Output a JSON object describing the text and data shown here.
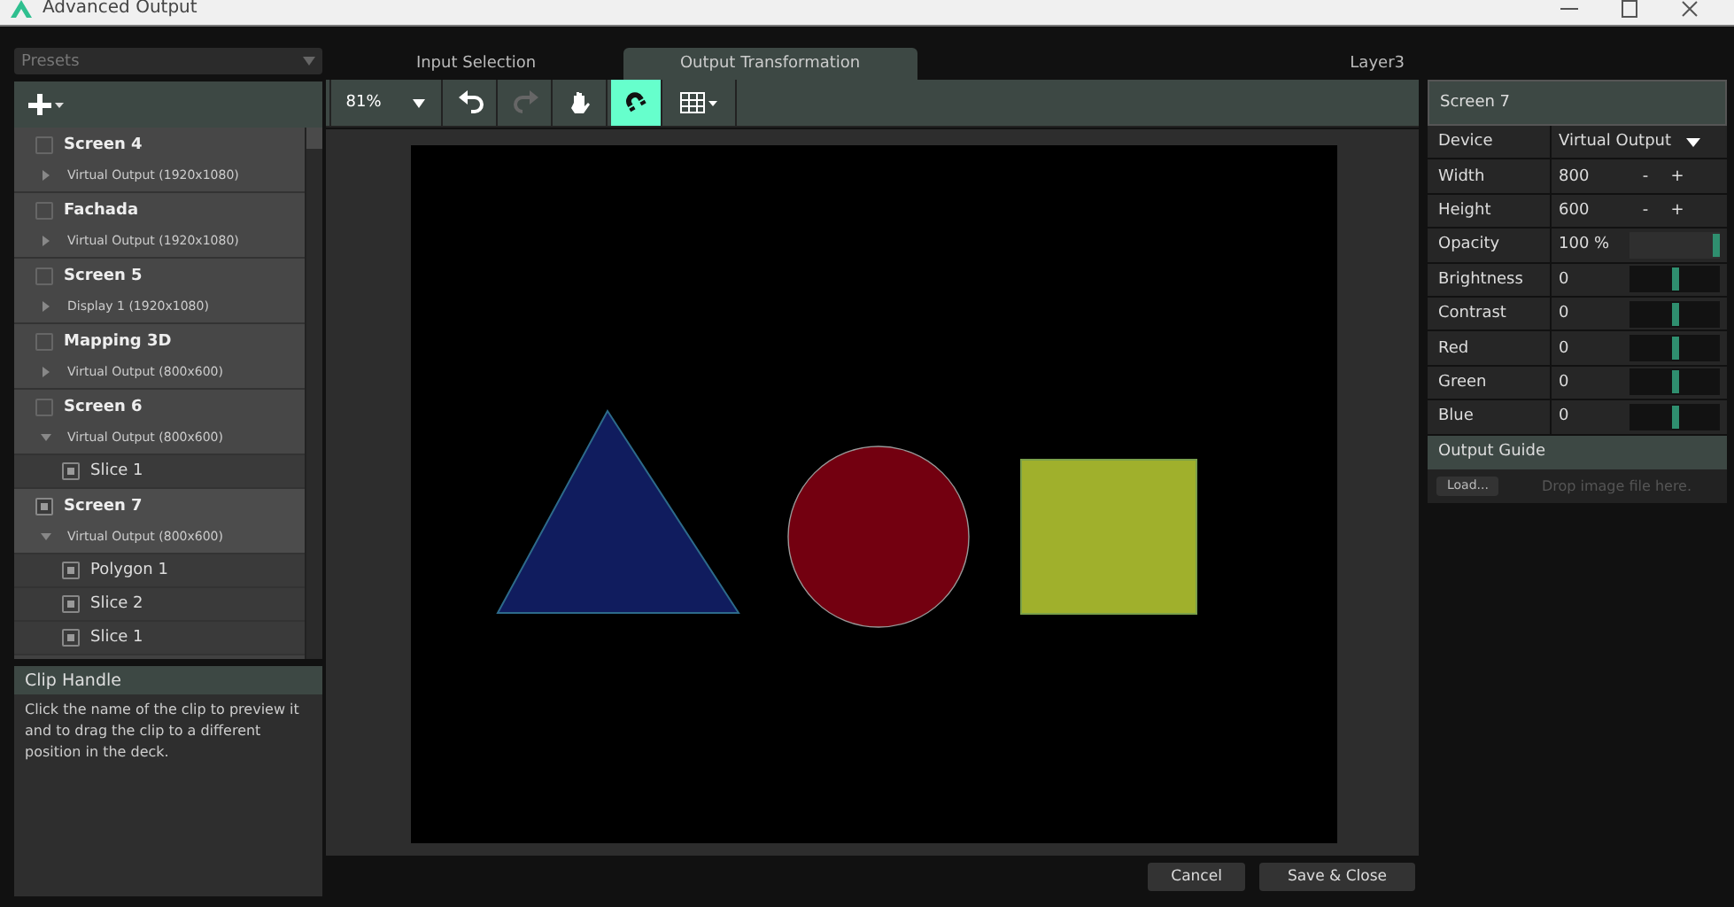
{
  "window": {
    "title": "Advanced Output"
  },
  "presets": {
    "placeholder": "Presets"
  },
  "tabs": [
    {
      "label": "Input Selection",
      "selected": false
    },
    {
      "label": "Output Transformation",
      "selected": true
    }
  ],
  "layer": "Layer3",
  "toolbar": {
    "zoom": "81%",
    "tools": [
      {
        "kind": "undo",
        "on": false,
        "disabled": false
      },
      {
        "kind": "redo",
        "on": false,
        "disabled": true
      },
      {
        "kind": "hand",
        "on": false,
        "disabled": false
      },
      {
        "kind": "magnet",
        "on": true,
        "disabled": false
      },
      {
        "kind": "grid",
        "on": false,
        "disabled": false
      }
    ]
  },
  "screens": [
    {
      "name": "Screen 4",
      "device": "Virtual Output (1920x1080)",
      "checked": false,
      "expanded": false
    },
    {
      "name": "Fachada",
      "device": "Virtual Output (1920x1080)",
      "checked": false,
      "expanded": false
    },
    {
      "name": "Screen 5",
      "device": "Display 1 (1920x1080)",
      "checked": false,
      "expanded": false
    },
    {
      "name": "Mapping 3D",
      "device": "Virtual Output (800x600)",
      "checked": false,
      "expanded": false
    },
    {
      "name": "Screen 6",
      "device": "Virtual Output (800x600)",
      "checked": false,
      "expanded": true,
      "children": [
        {
          "name": "Slice 1",
          "checked": true
        }
      ]
    },
    {
      "name": "Screen 7",
      "device": "Virtual Output (800x600)",
      "checked": true,
      "expanded": true,
      "children": [
        {
          "name": "Polygon 1",
          "checked": true
        },
        {
          "name": "Slice 2",
          "checked": true
        },
        {
          "name": "Slice 1",
          "checked": true
        }
      ]
    }
  ],
  "help": {
    "title": "Clip Handle",
    "text": "Click the name of the clip to preview it and to drag the clip to a different position in the deck."
  },
  "canvas": {
    "shapes": [
      {
        "kind": "triangle",
        "color": "#101c5e"
      },
      {
        "kind": "circle",
        "color": "#730010"
      },
      {
        "kind": "square",
        "color": "#a0b02c"
      }
    ]
  },
  "properties": {
    "title": "Screen 7",
    "rows": [
      {
        "kind": "dropdown",
        "label": "Device",
        "value": "Virtual Output"
      },
      {
        "kind": "stepper",
        "label": "Width",
        "value": "800",
        "minus": "-",
        "plus": "+"
      },
      {
        "kind": "stepper",
        "label": "Height",
        "value": "600",
        "minus": "-",
        "plus": "+"
      },
      {
        "kind": "slider",
        "label": "Opacity",
        "value": "100 %",
        "level": 1
      },
      {
        "kind": "slider",
        "label": "Brightness",
        "value": "0",
        "level": 0.5
      },
      {
        "kind": "slider",
        "label": "Contrast",
        "value": "0",
        "level": 0.5
      },
      {
        "kind": "slider",
        "label": "Red",
        "value": "0",
        "level": 0.5
      },
      {
        "kind": "slider",
        "label": "Green",
        "value": "0",
        "level": 0.5
      },
      {
        "kind": "slider",
        "label": "Blue",
        "value": "0",
        "level": 0.5
      }
    ],
    "guide": {
      "title": "Output Guide",
      "button": "Load...",
      "placeholder": "Drop image file here."
    }
  },
  "buttons": [
    "Cancel",
    "Save & Close"
  ]
}
